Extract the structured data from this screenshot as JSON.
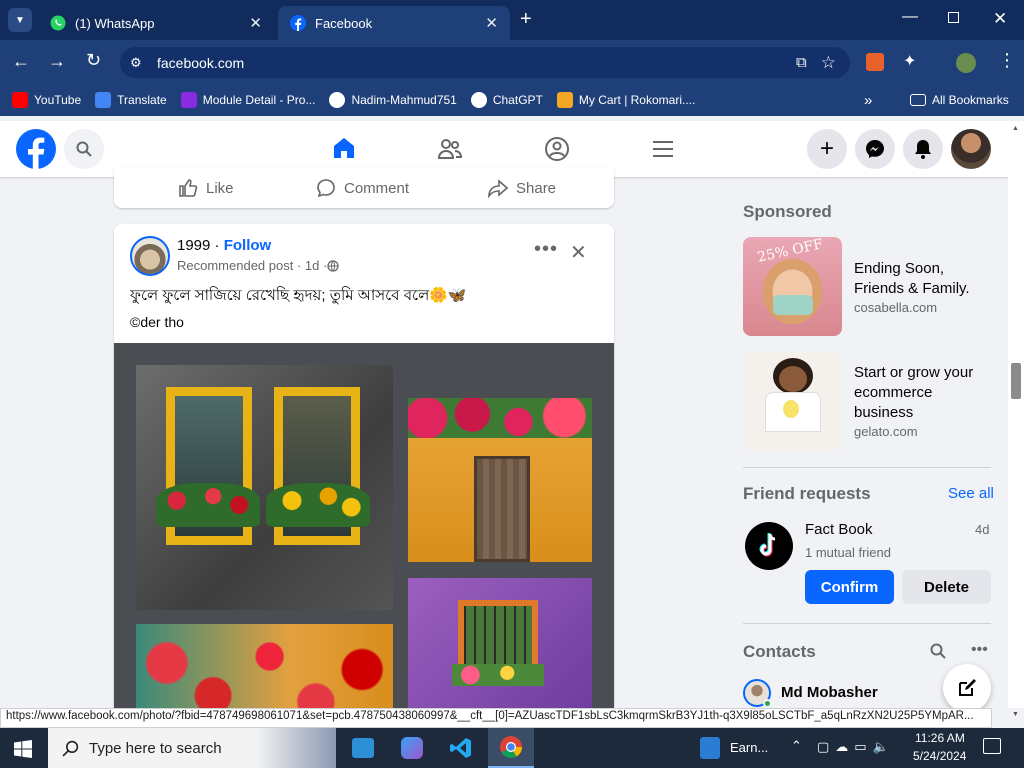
{
  "browser": {
    "tabs": [
      {
        "title": "(1) WhatsApp"
      },
      {
        "title": "Facebook"
      }
    ],
    "url": "facebook.com",
    "bookmarks": [
      "YouTube",
      "Translate",
      "Module Detail - Pro...",
      "Nadim-Mahmud751",
      "ChatGPT",
      "My Cart | Rokomari...."
    ],
    "all_bookmarks": "All Bookmarks"
  },
  "post_actions": {
    "like": "Like",
    "comment": "Comment",
    "share": "Share"
  },
  "post": {
    "author": "1999",
    "separator": " · ",
    "follow": "Follow",
    "meta": "Recommended post · 1d · ",
    "text": "ফুলে ফুলে সাজিয়ে রেখেছি হৃদয়; তুমি আসবে বলে🌼🦋",
    "credit": "©der tho"
  },
  "sponsored": {
    "heading": "Sponsored",
    "ads": [
      {
        "title": "Ending Soon, Friends & Family.",
        "domain": "cosabella.com",
        "badge": "25% OFF"
      },
      {
        "title": "Start or grow your ecommerce business",
        "domain": "gelato.com"
      }
    ]
  },
  "friend_requests": {
    "heading": "Friend requests",
    "see_all": "See all",
    "name": "Fact Book",
    "age": "4d",
    "mutual": "1 mutual friend",
    "confirm": "Confirm",
    "delete": "Delete"
  },
  "contacts": {
    "heading": "Contacts",
    "first": "Md Mobasher"
  },
  "status_url": "https://www.facebook.com/photo/?fbid=478749698061071&set=pcb.478750438060997&__cft__[0]=AZUascTDF1sbLsC3kmqrmSkrB3YJ1th-q3X9l85oLSCTbF_a5qLnRzXN2U25P5YMpAR...",
  "taskbar": {
    "search_placeholder": "Type here to search",
    "app_label": "Earn...",
    "time": "11:26 AM",
    "date": "5/24/2024"
  },
  "colors": {
    "fb_blue": "#0866ff",
    "chrome_dark": "#112b5c",
    "chrome_mid": "#1f3f79"
  }
}
